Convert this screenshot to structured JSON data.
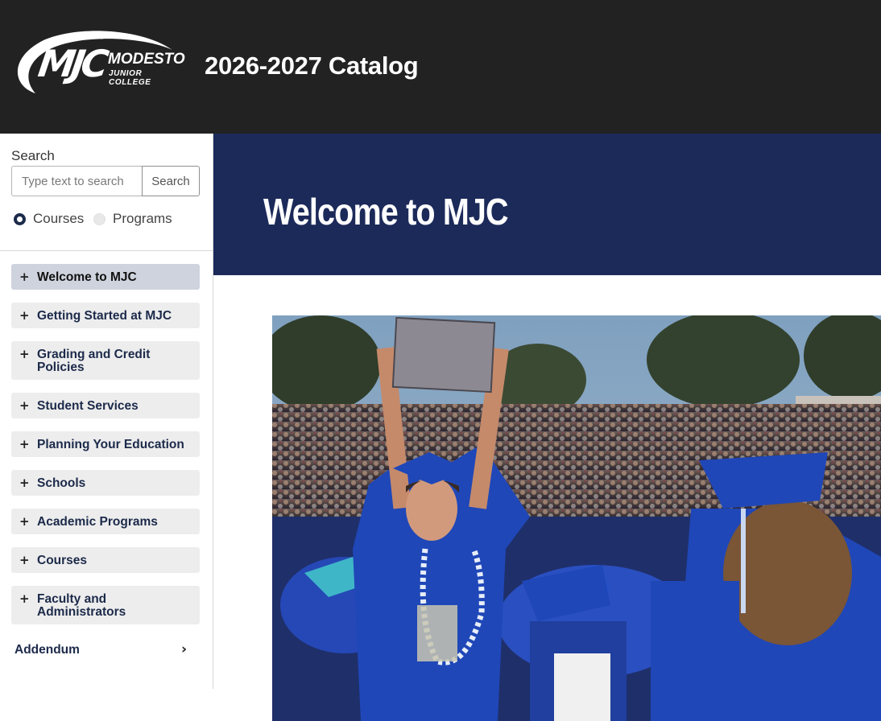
{
  "header": {
    "logo": {
      "mark": "MJC",
      "line1": "MODESTO",
      "line2": "JUNIOR COLLEGE"
    },
    "title": "2026-2027 Catalog",
    "background": "#222222"
  },
  "sidebar": {
    "search": {
      "label": "Search",
      "placeholder": "Type text to search",
      "value": "",
      "button_label": "Search",
      "options": [
        {
          "label": "Courses",
          "selected": true
        },
        {
          "label": "Programs",
          "selected": false
        }
      ]
    },
    "nav": [
      {
        "label": "Welcome to MJC",
        "active": true
      },
      {
        "label": "Getting Started at MJC",
        "active": false
      },
      {
        "label": "Grading and Credit Policies",
        "active": false
      },
      {
        "label": "Student Services",
        "active": false
      },
      {
        "label": "Planning Your Education",
        "active": false
      },
      {
        "label": "Schools",
        "active": false
      },
      {
        "label": "Academic Programs",
        "active": false
      },
      {
        "label": "Courses",
        "active": false
      },
      {
        "label": "Faculty and Administrators",
        "active": false
      }
    ],
    "expand_glyph": "+",
    "addendum": {
      "label": "Addendum",
      "chevron": "›"
    }
  },
  "main": {
    "banner_title": "Welcome to MJC",
    "banner_color": "#1c2a5a",
    "photo_subject": "graduate in blue cap and gown holding diploma cover at commencement"
  },
  "colors": {
    "navy": "#1c2a5a",
    "nav_item_bg": "#ededed",
    "nav_item_active_bg": "#cfd3dd",
    "gown_blue": "#1f47b8"
  }
}
